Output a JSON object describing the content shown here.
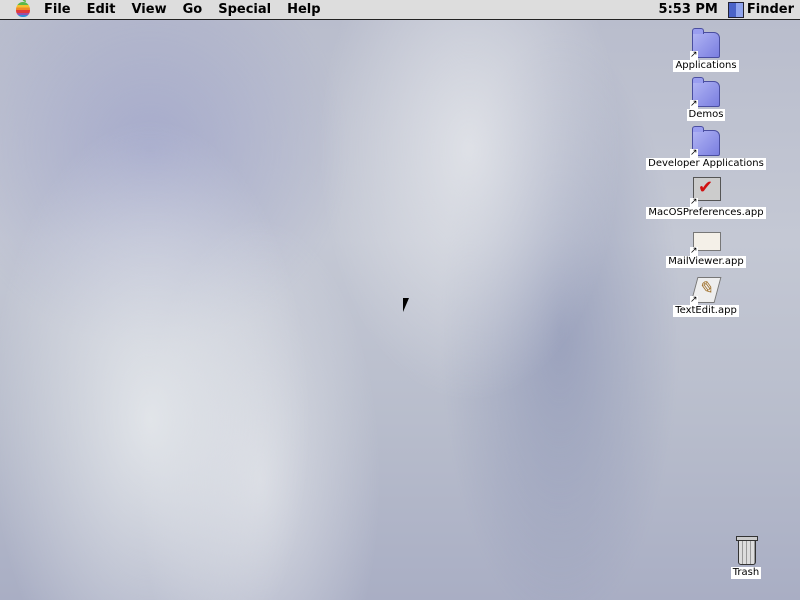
{
  "menubar": {
    "items": [
      "File",
      "Edit",
      "View",
      "Go",
      "Special",
      "Help"
    ],
    "clock": "5:53 PM",
    "app": "Finder"
  },
  "desktop": {
    "icons": [
      {
        "label": "Applications",
        "icon": "folder-alias-icon"
      },
      {
        "label": "Demos",
        "icon": "folder-alias-icon"
      },
      {
        "label": "Developer Applications",
        "icon": "folder-alias-icon"
      },
      {
        "label": "MacOSPreferences.app",
        "icon": "monitor-checkmark-icon"
      },
      {
        "label": "MailViewer.app",
        "icon": "mail-envelope-icon"
      },
      {
        "label": "TextEdit.app",
        "icon": "pen-notepad-icon"
      }
    ],
    "trash": {
      "label": "Trash",
      "icon": "trash-icon"
    }
  }
}
